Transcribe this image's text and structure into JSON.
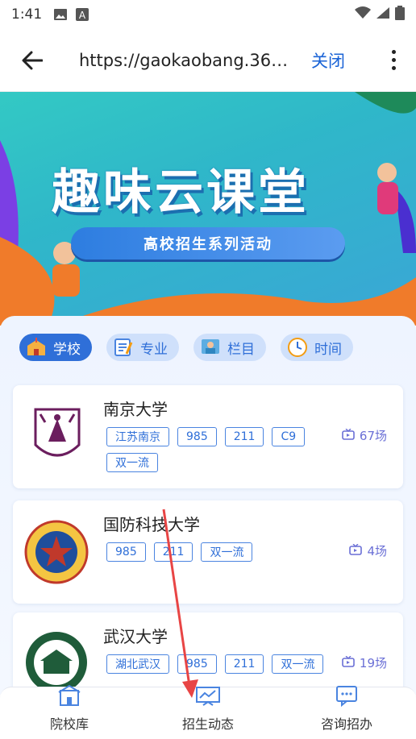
{
  "status_bar": {
    "time": "1:41"
  },
  "nav": {
    "url": "https://gaokaobang.36…",
    "close_label": "关闭"
  },
  "banner": {
    "title": "趣味云课堂",
    "subtitle": "高校招生系列活动"
  },
  "filters": [
    {
      "label": "学校",
      "icon": "school-icon",
      "active": true
    },
    {
      "label": "专业",
      "icon": "major-icon",
      "active": false
    },
    {
      "label": "栏目",
      "icon": "column-icon",
      "active": false
    },
    {
      "label": "时间",
      "icon": "clock-icon",
      "active": false
    }
  ],
  "universities": [
    {
      "name": "南京大学",
      "tags": [
        "江苏南京",
        "985",
        "211",
        "C9",
        "双一流"
      ],
      "count": "67场",
      "logo_color": "#6b1e5e"
    },
    {
      "name": "国防科技大学",
      "tags": [
        "985",
        "211",
        "双一流"
      ],
      "count": "4场",
      "logo_color": "#c0392b"
    },
    {
      "name": "武汉大学",
      "tags": [
        "湖北武汉",
        "985",
        "211",
        "双一流"
      ],
      "count": "19场",
      "logo_color": "#1f5c3a"
    }
  ],
  "tab_bar": [
    {
      "label": "院校库",
      "icon": "building-icon"
    },
    {
      "label": "招生动态",
      "icon": "chart-board-icon"
    },
    {
      "label": "咨询招办",
      "icon": "consult-icon"
    }
  ],
  "colors": {
    "accent": "#2f6fd8",
    "close": "#1a63d6",
    "count": "#6a6fd6"
  }
}
